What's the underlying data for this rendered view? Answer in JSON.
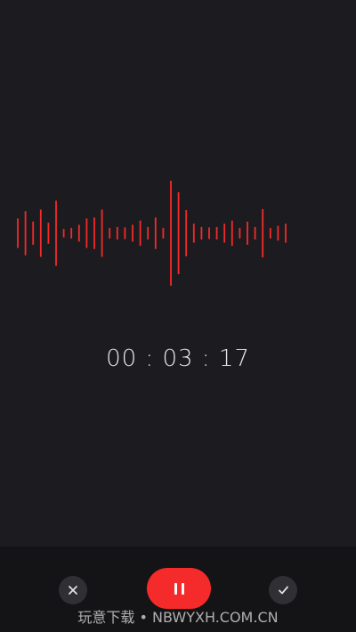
{
  "recorder": {
    "elapsed_time": "00 : 03 : 17",
    "accent_color": "#f52a2a",
    "waveform_levels": [
      0.28,
      0.42,
      0.22,
      0.45,
      0.2,
      0.62,
      0.08,
      0.1,
      0.16,
      0.28,
      0.3,
      0.45,
      0.1,
      0.12,
      0.11,
      0.16,
      0.24,
      0.12,
      0.3,
      0.1,
      1.0,
      0.78,
      0.44,
      0.18,
      0.12,
      0.11,
      0.12,
      0.18,
      0.24,
      0.1,
      0.22,
      0.12,
      0.46,
      0.1,
      0.14,
      0.18
    ]
  },
  "controls": {
    "cancel_icon": "close-icon",
    "pause_icon": "pause-icon",
    "confirm_icon": "check-icon"
  },
  "watermark": {
    "text": "玩意下载 • NBWYXH.COM.CN"
  }
}
